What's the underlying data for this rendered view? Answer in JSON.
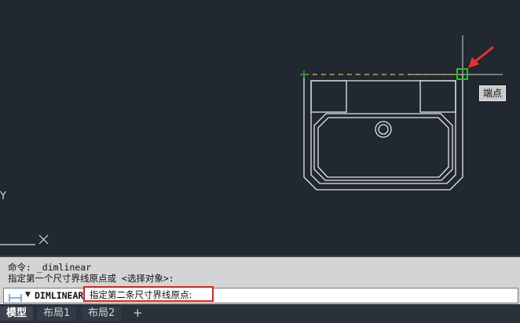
{
  "canvas": {
    "tooltip": "端点",
    "ucs_y_label": "Y"
  },
  "command": {
    "history": [
      "命令: _dimlinear",
      "指定第一个尺寸界线原点或 <选择对象>:"
    ],
    "command_name": "DIMLINEAR",
    "prompt": "指定第二条尺寸界线原点:"
  },
  "tabs": {
    "model": "模型",
    "layout1": "布局1",
    "layout2": "布局2",
    "add": "+"
  },
  "colors": {
    "background": "#212830",
    "geometry": "#e6e6e6",
    "snap_marker": "#27c227",
    "highlight_box": "#e0201a",
    "arrow": "#e8322b"
  }
}
